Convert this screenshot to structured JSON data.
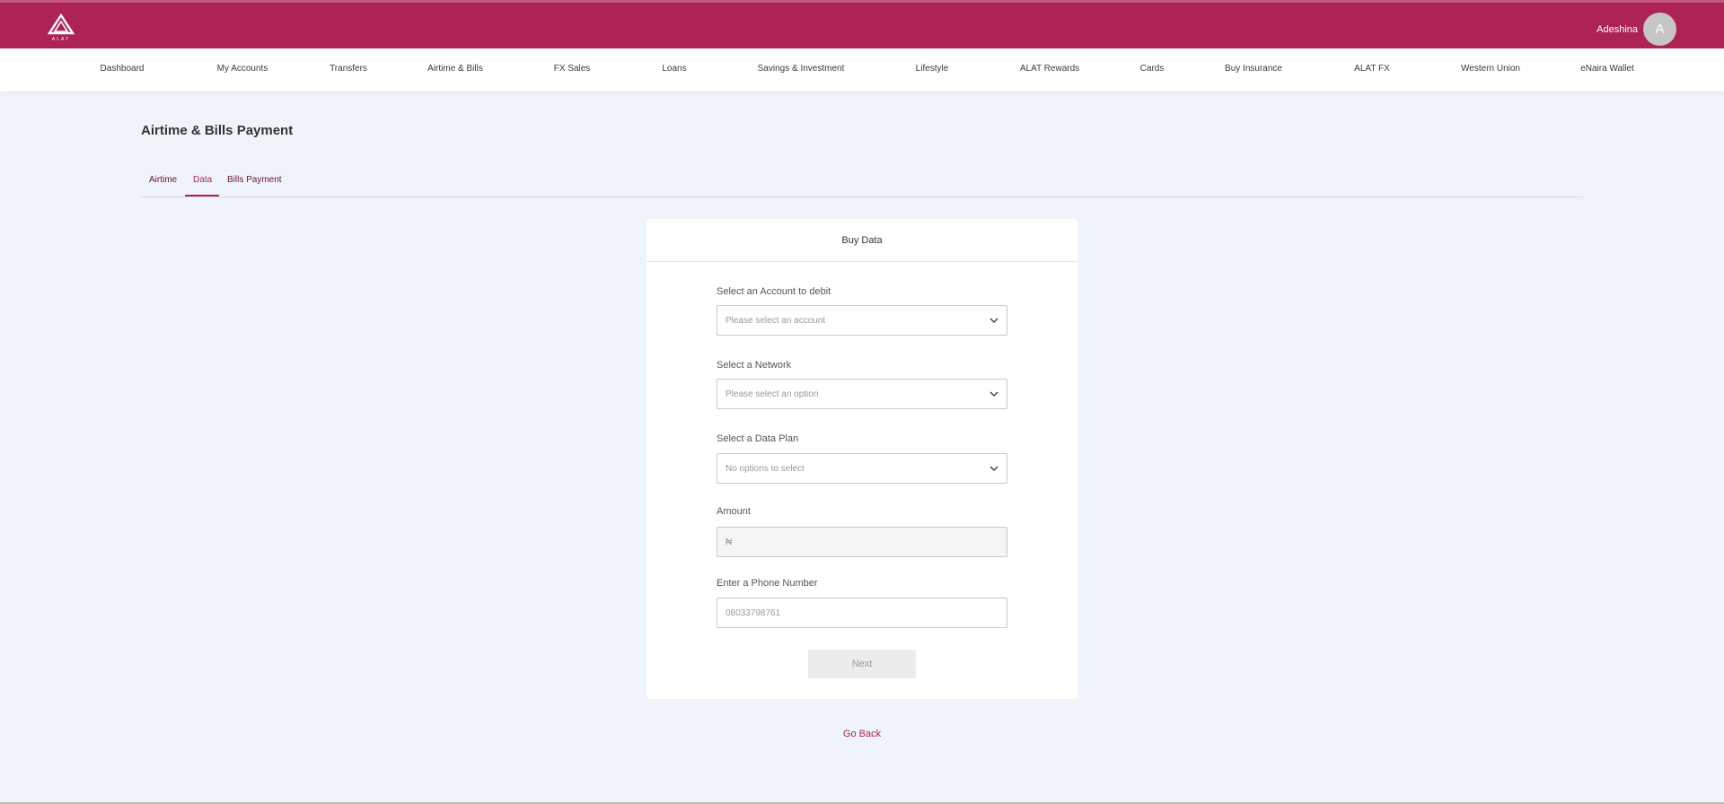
{
  "header": {
    "user_name": "Adeshina",
    "avatar_initial": "A",
    "brand_color": "#ad2356",
    "logo_icon": "alat-logo-icon"
  },
  "nav": {
    "items": [
      {
        "label": "Dashboard"
      },
      {
        "label": "My Accounts"
      },
      {
        "label": "Transfers"
      },
      {
        "label": "Airtime & Bills"
      },
      {
        "label": "FX Sales"
      },
      {
        "label": "Loans"
      },
      {
        "label": "Savings & Investment"
      },
      {
        "label": "Lifestyle"
      },
      {
        "label": "ALAT Rewards"
      },
      {
        "label": "Cards"
      },
      {
        "label": "Buy Insurance"
      },
      {
        "label": "ALAT FX"
      },
      {
        "label": "Western Union"
      },
      {
        "label": "eNaira Wallet"
      }
    ]
  },
  "page": {
    "title": "Airtime & Bills Payment",
    "tabs": [
      {
        "label": "Airtime",
        "active": false
      },
      {
        "label": "Data",
        "active": true
      },
      {
        "label": "Bills Payment",
        "active": false
      }
    ]
  },
  "form": {
    "title": "Buy Data",
    "account_label": "Select an Account to debit",
    "account_placeholder": "Please select an account",
    "network_label": "Select a Network",
    "network_placeholder": "Please select an option",
    "plan_label": "Select a Data Plan",
    "plan_placeholder": "No options to select",
    "amount_label": "Amount",
    "amount_prefix": "₦",
    "phone_label": "Enter a Phone Number",
    "phone_placeholder": "08033798761",
    "next_label": "Next",
    "go_back_label": "Go Back"
  }
}
